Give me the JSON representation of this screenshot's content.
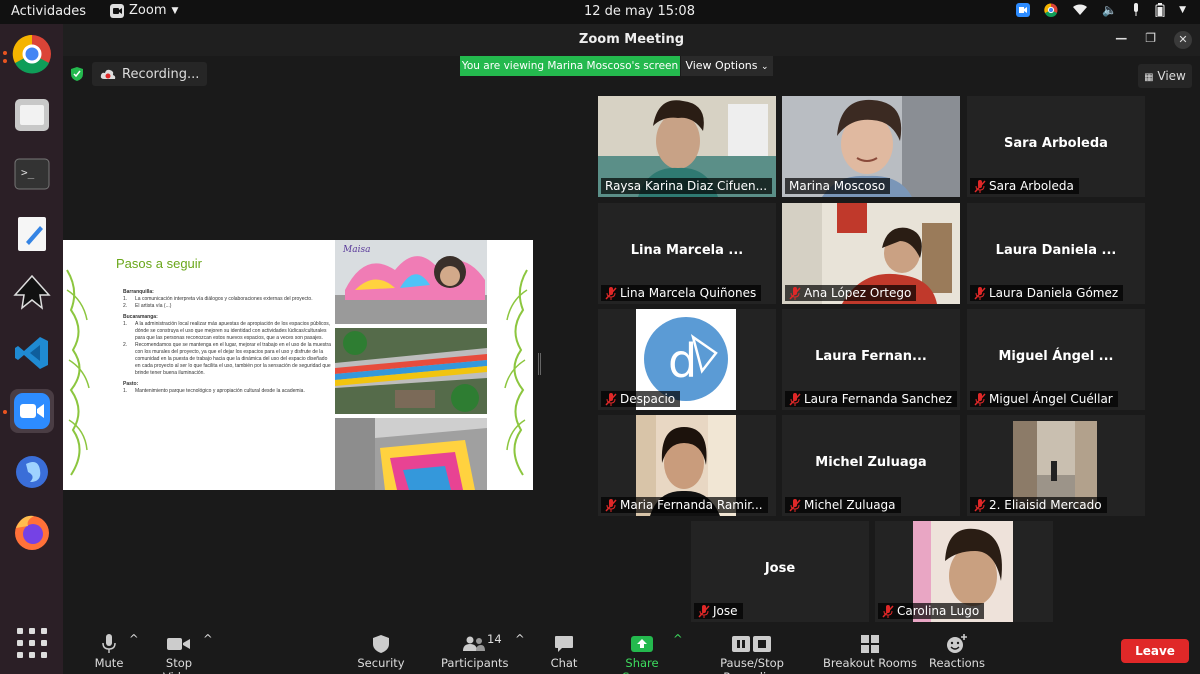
{
  "system_bar": {
    "activities": "Actividades",
    "app_menu": "Zoom",
    "clock": "12 de may  15:08"
  },
  "window": {
    "title": "Zoom Meeting"
  },
  "meeting": {
    "recording": "Recording...",
    "viewing_banner": "You are viewing Marina Moscoso's screen",
    "view_options": "View Options",
    "view_button": "View"
  },
  "shared_slide": {
    "title": "Pasos a seguir",
    "sections": [
      {
        "heading": "Barranquilla:",
        "items": [
          "La comunicación interpreta vía diálogos y colaboraciones externas del proyecto.",
          "El artista vía (...)"
        ]
      },
      {
        "heading": "Bucaramanga:",
        "items": [
          "A la administración local realizar más apuestas de apropiación de los espacios públicos, dónde se construya el uso que mejoren su identidad con actividades lúdicas/culturales para que las personas reconozcan estos nuevos espacios, que a veces son pasajes.",
          "Recomendamos que se mantenga en el lugar, mejorar el trabajo en el uso de la muestra con los murales del proyecto, ya que el dejar los espacios para el uso y disfrute de la comunidad en la puesta de trabajo hacia que la dinámica del uso del espacio diseñado en cada proyecto al ser lo que facilita el uso, también por la sensación de seguridad que brinde tener buena iluminación."
        ]
      },
      {
        "heading": "Pasto:",
        "items": [
          "Mantenimiento parque tecnológico y apropiación cultural desde la academia."
        ]
      }
    ]
  },
  "participants_tiles": [
    {
      "name": "Raysa Karina Diaz Cifuen...",
      "big": "",
      "muted": false,
      "video": true,
      "active": false
    },
    {
      "name": "Marina Moscoso",
      "big": "",
      "muted": false,
      "video": true,
      "active": true
    },
    {
      "name": "Sara Arboleda",
      "big": "Sara Arboleda",
      "muted": true,
      "video": false,
      "active": false
    },
    {
      "name": "Lina Marcela Quiñones",
      "big": "Lina Marcela ...",
      "muted": true,
      "video": false,
      "active": false
    },
    {
      "name": "Ana López Ortego",
      "big": "",
      "muted": true,
      "video": true,
      "active": false
    },
    {
      "name": "Laura Daniela Gómez",
      "big": "Laura Daniela ...",
      "muted": true,
      "video": false,
      "active": false
    },
    {
      "name": "Despacio",
      "big": "",
      "muted": true,
      "video": true,
      "active": false
    },
    {
      "name": "Laura Fernanda Sanchez",
      "big": "Laura Fernan...",
      "muted": true,
      "video": false,
      "active": false
    },
    {
      "name": "Miguel Ángel Cuéllar",
      "big": "Miguel Ángel ...",
      "muted": true,
      "video": false,
      "active": false
    },
    {
      "name": "Maria Fernanda Ramir...",
      "big": "",
      "muted": true,
      "video": true,
      "active": false
    },
    {
      "name": "Michel Zuluaga",
      "big": "Michel Zuluaga",
      "muted": true,
      "video": false,
      "active": false
    },
    {
      "name": "2. Eliaisid Mercado",
      "big": "",
      "muted": true,
      "video": true,
      "active": false
    },
    {
      "name": "Jose",
      "big": "Jose",
      "muted": true,
      "video": false,
      "active": false
    },
    {
      "name": "Carolina Lugo",
      "big": "",
      "muted": true,
      "video": true,
      "active": false
    }
  ],
  "toolbar": {
    "mute": "Mute",
    "stop_video": "Stop Video",
    "security": "Security",
    "participants": "Participants",
    "participants_count": "14",
    "chat": "Chat",
    "share_screen": "Share Screen",
    "pause_recording": "Pause/Stop Recording",
    "breakout_rooms": "Breakout Rooms",
    "reactions": "Reactions",
    "leave": "Leave"
  },
  "colors": {
    "accent_green": "#24b94e",
    "active_outline": "#3ddc5e",
    "leave_red": "#e02828",
    "slide_title_green": "#6aa71a"
  },
  "icons": {
    "dock": [
      "chrome-icon",
      "files-icon",
      "terminal-icon",
      "text-editor-icon",
      "inkscape-icon",
      "vscode-icon",
      "zoom-icon",
      "gnome-icon",
      "firefox-icon",
      "show-apps-icon"
    ]
  }
}
